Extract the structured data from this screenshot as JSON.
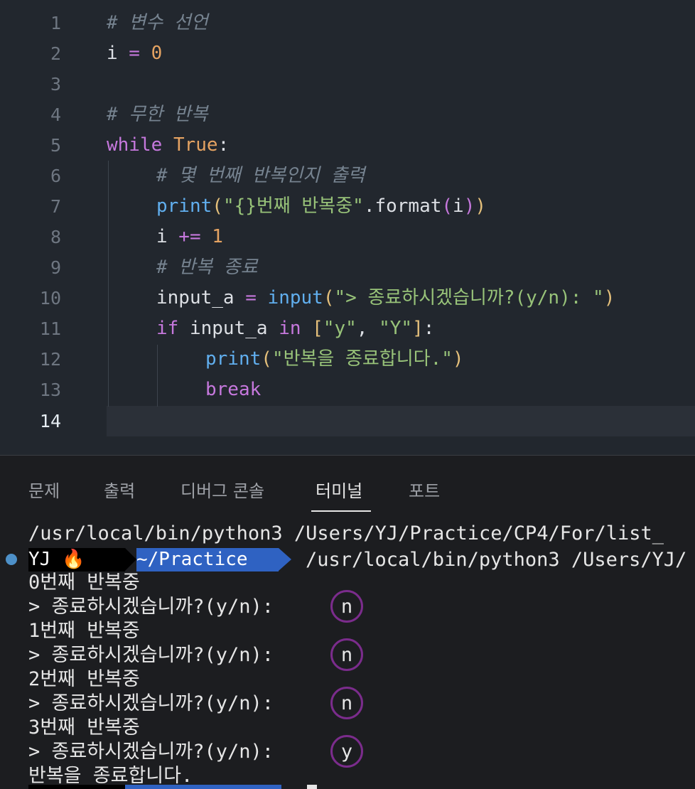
{
  "editor": {
    "line_numbers": [
      "1",
      "2",
      "3",
      "4",
      "5",
      "6",
      "7",
      "8",
      "9",
      "10",
      "11",
      "12",
      "13",
      "14"
    ],
    "l1_comment": "# 변수 선언",
    "l2": {
      "var": "i",
      "op": " = ",
      "num": "0"
    },
    "l4_comment": "# 무한 반복",
    "l5": {
      "kw": "while",
      "bool": "True",
      "colon": ":"
    },
    "l6_comment": "# 몇 번째 반복인지 출력",
    "l7": {
      "fn": "print",
      "p1": "(",
      "str": "\"{}번째 반복중\"",
      "method": ".format",
      "p2": "(",
      "arg": "i",
      "p2c": ")",
      "p1c": ")"
    },
    "l8": {
      "var": "i",
      "op": " += ",
      "num": "1"
    },
    "l9_comment": "# 반복 종료",
    "l10": {
      "var": "input_a",
      "op": " = ",
      "fn": "input",
      "p1": "(",
      "str": "\"> 종료하시겠습니까?(y/n): \"",
      "p1c": ")"
    },
    "l11": {
      "kw": "if",
      "var": " input_a ",
      "kw2": "in",
      "b1": "[",
      "s1": "\"y\"",
      "comma": ", ",
      "s2": "\"Y\"",
      "b1c": "]",
      "colon": ":"
    },
    "l12": {
      "fn": "print",
      "p1": "(",
      "str": "\"반복을 종료합니다.\"",
      "p1c": ")"
    },
    "l13": {
      "kw": "break"
    }
  },
  "panel": {
    "tabs": [
      "문제",
      "출력",
      "디버그 콘솔",
      "터미널",
      "포트"
    ],
    "active_tab": "터미널"
  },
  "terminal": {
    "command_line": "/usr/local/bin/python3 /Users/YJ/Practice/CP4/For/list_",
    "prompt_user": " YJ 🔥",
    "prompt_dir": " ~/Practice",
    "prompt_command": "/usr/local/bin/python3 /Users/YJ/",
    "lines": [
      "0번째 반복중",
      "> 종료하시겠습니까?(y/n): ",
      "1번째 반복중",
      "> 종료하시겠습니까?(y/n): ",
      "2번째 반복중",
      "> 종료하시겠습니까?(y/n): ",
      "3번째 반복중",
      "> 종료하시겠습니까?(y/n): ",
      "반복을 종료합니다."
    ],
    "answers": [
      "n",
      "n",
      "n",
      "y"
    ]
  },
  "colors": {
    "annotation_circle": "#7b2c8c",
    "prompt_dir_bg": "#2f62c2",
    "status_dot": "#4d90c8"
  }
}
